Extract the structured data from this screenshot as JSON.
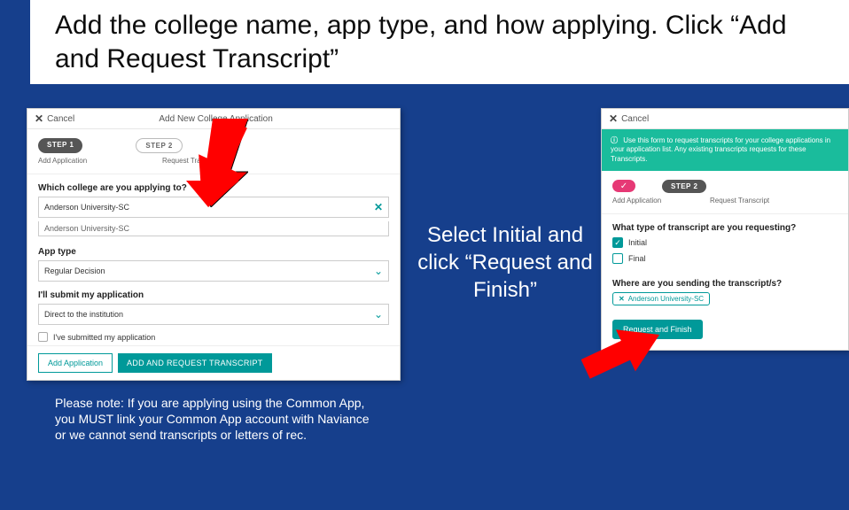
{
  "title": "Add the college name, app type, and how applying. Click “Add and Request Transcript”",
  "mid_text": "Select Initial and click “Request and Finish”",
  "note": "Please note: If you are applying using the Common App, you MUST link your Common App account with Naviance or we cannot send transcripts or letters of rec.",
  "left": {
    "cancel": "Cancel",
    "header_title": "Add New College Application",
    "step1": "STEP 1",
    "step2": "STEP 2",
    "step1_sub": "Add Application",
    "step2_sub": "Request Transcript",
    "q_college": "Which college are you applying to?",
    "college_value": "Anderson University-SC",
    "suggestion": "Anderson University-SC",
    "app_type_label": "App type",
    "app_type_value": "Regular Decision",
    "submit_label": "I'll submit my application",
    "submit_value": "Direct to the institution",
    "checkbox_label": "I've submitted my application",
    "btn_outline": "Add Application",
    "btn_filled": "ADD AND REQUEST TRANSCRIPT"
  },
  "right": {
    "cancel": "Cancel",
    "info": "Use this form to request transcripts for your college applications in your application list. Any existing transcripts requests for these Transcripts.",
    "step2": "STEP 2",
    "step1_sub": "Add Application",
    "step2_sub": "Request Transcript",
    "q_type": "What type of transcript are you requesting?",
    "opt_initial": "Initial",
    "opt_final": "Final",
    "q_send": "Where are you sending the transcript/s?",
    "tag": "Anderson University-SC",
    "btn": "Request and Finish"
  }
}
